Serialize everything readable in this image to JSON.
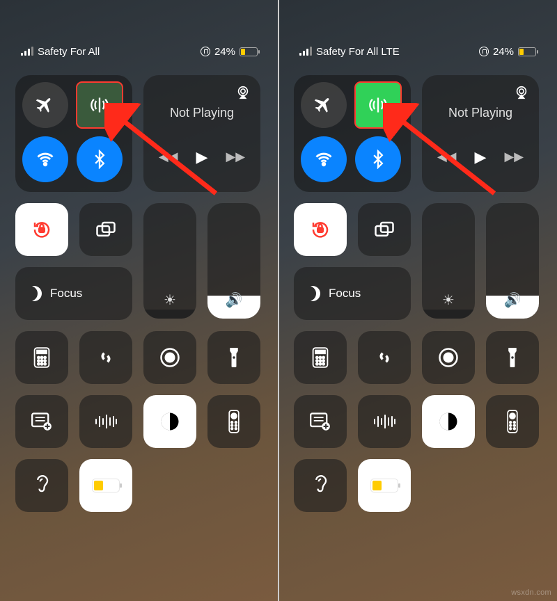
{
  "left": {
    "carrier": "Safety For All",
    "battery_pct": "24%",
    "not_playing": "Not Playing",
    "focus": "Focus",
    "cellular_active": false
  },
  "right": {
    "carrier": "Safety For All LTE",
    "battery_pct": "24%",
    "not_playing": "Not Playing",
    "focus": "Focus",
    "cellular_active": true
  },
  "icons": {
    "airplane": "airplane-icon",
    "cellular": "cellular-data-icon",
    "wifi": "wifi-icon",
    "bluetooth": "bluetooth-icon",
    "airplay": "airplay-icon",
    "back": "back-icon",
    "play": "play-icon",
    "fwd": "forward-icon",
    "lock_rotation": "rotation-lock-icon",
    "mirror": "screen-mirror-icon",
    "moon": "moon-icon",
    "brightness": "brightness-icon",
    "volume": "volume-icon",
    "calculator": "calculator-icon",
    "shazam": "shazam-icon",
    "record": "screen-record-icon",
    "flashlight": "flashlight-icon",
    "notes": "quick-note-icon",
    "voice": "voice-memo-icon",
    "darkmode": "dark-mode-icon",
    "remote": "tv-remote-icon",
    "hearing": "hearing-icon",
    "lowpower": "low-power-icon"
  },
  "watermark": "wsxdn.com"
}
